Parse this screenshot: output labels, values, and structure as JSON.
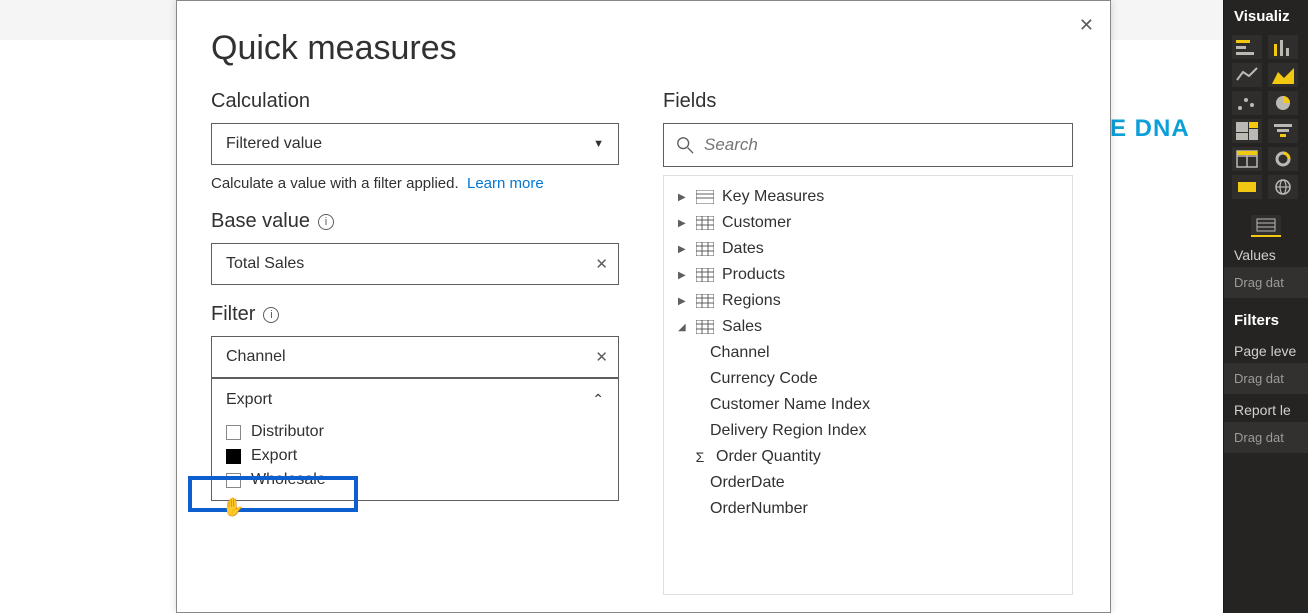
{
  "dialog": {
    "title": "Quick measures",
    "calculation": {
      "label": "Calculation",
      "selected": "Filtered value",
      "hint": "Calculate a value with a filter applied.",
      "learn_more": "Learn more"
    },
    "base_value": {
      "label": "Base value",
      "value": "Total Sales"
    },
    "filter": {
      "label": "Filter",
      "value": "Channel",
      "dropdown_header": "Export",
      "options": {
        "distributor": {
          "label": "Distributor",
          "checked": false
        },
        "export": {
          "label": "Export",
          "checked": true
        },
        "wholesale": {
          "label": "Wholesale",
          "checked": false
        }
      }
    },
    "fields": {
      "label": "Fields",
      "search_placeholder": "Search",
      "tree": {
        "key_measures": "Key Measures",
        "customer": "Customer",
        "dates": "Dates",
        "products": "Products",
        "regions": "Regions",
        "sales": {
          "label": "Sales",
          "children": {
            "channel": "Channel",
            "currency_code": "Currency Code",
            "customer_name_index": "Customer Name Index",
            "delivery_region_index": "Delivery Region Index",
            "order_quantity": "Order Quantity",
            "order_date": "OrderDate",
            "order_number": "OrderNumber"
          }
        }
      }
    }
  },
  "viz_panel": {
    "title": "Visualiz",
    "values_label": "Values",
    "drag_hint": "Drag dat",
    "filters_title": "Filters",
    "page_level": "Page leve",
    "report_level": "Report le"
  },
  "bg_logo": "E DNA"
}
